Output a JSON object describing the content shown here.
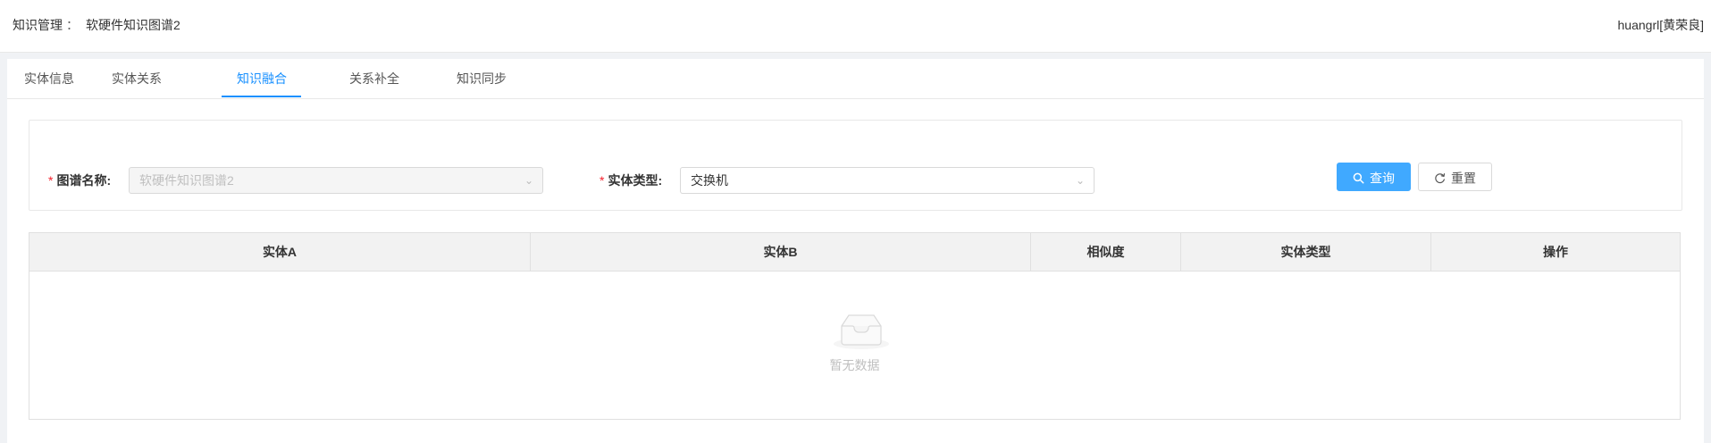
{
  "header": {
    "breadcrumb_root": "知识管理",
    "breadcrumb_sep": "：",
    "breadcrumb_current": "软硬件知识图谱2",
    "user": "huangrl[黄荣良]"
  },
  "tabs": [
    {
      "label": "实体信息",
      "active": false
    },
    {
      "label": "实体关系",
      "active": false
    },
    {
      "label": "知识融合",
      "active": true
    },
    {
      "label": "关系补全",
      "active": false
    },
    {
      "label": "知识同步",
      "active": false
    }
  ],
  "form": {
    "graph_name_label": "图谱名称",
    "graph_name_value": "软硬件知识图谱2",
    "entity_type_label": "实体类型",
    "entity_type_value": "交换机",
    "required_mark": "*",
    "colon": ":",
    "query_button": "查询",
    "reset_button": "重置",
    "icons": {
      "query": "search-icon",
      "reset": "reload-icon",
      "select": "chevron-down-icon"
    }
  },
  "table": {
    "columns": [
      "实体A",
      "实体B",
      "相似度",
      "实体类型",
      "操作"
    ],
    "rows": [],
    "empty_text": "暂无数据"
  },
  "colors": {
    "primary": "#1890ff",
    "button_primary": "#40a9ff",
    "required": "#f5222d"
  }
}
